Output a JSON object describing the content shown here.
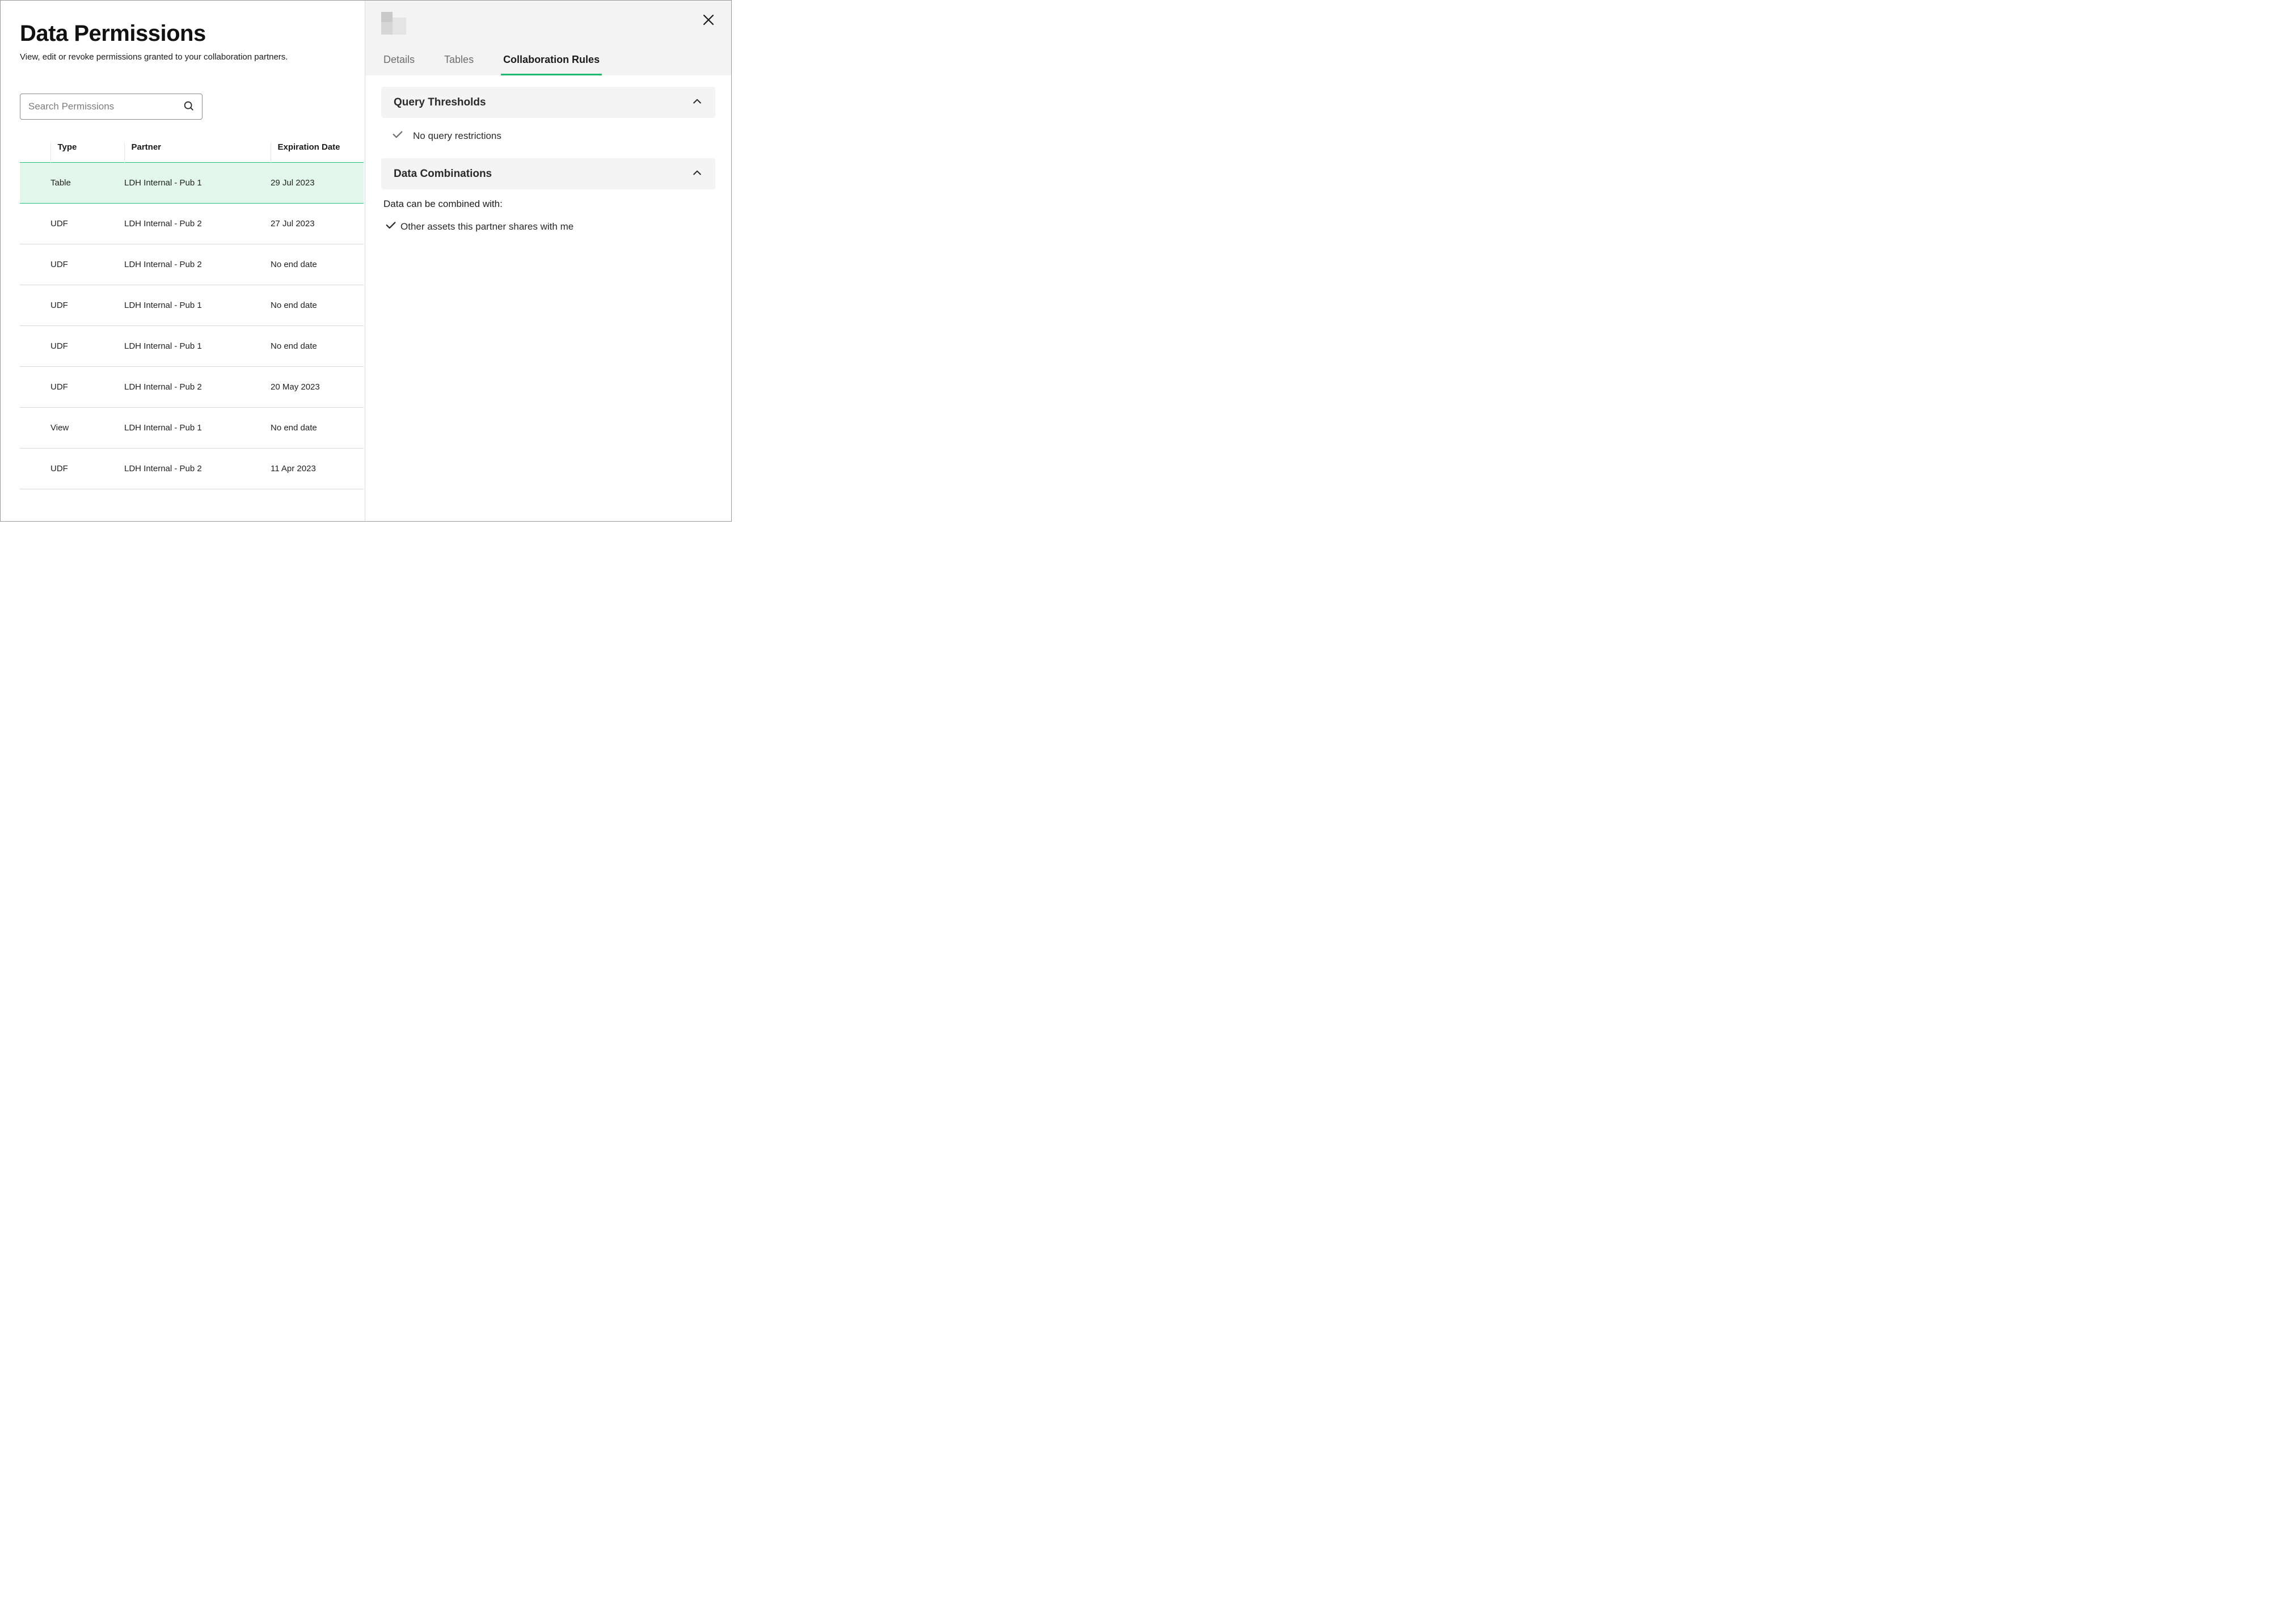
{
  "page": {
    "title": "Data Permissions",
    "subtitle": "View, edit or revoke permissions granted to your collaboration partners."
  },
  "search": {
    "placeholder": "Search Permissions"
  },
  "table": {
    "columns": {
      "type": "Type",
      "partner": "Partner",
      "expiration": "Expiration Date"
    },
    "rows": [
      {
        "type": "Table",
        "partner": "LDH Internal - Pub 1",
        "expiration": "29 Jul 2023",
        "selected": true
      },
      {
        "type": "UDF",
        "partner": "LDH Internal - Pub 2",
        "expiration": "27 Jul 2023"
      },
      {
        "type": "UDF",
        "partner": "LDH Internal - Pub 2",
        "expiration": "No end date"
      },
      {
        "type": "UDF",
        "partner": "LDH Internal - Pub 1",
        "expiration": "No end date"
      },
      {
        "type": "UDF",
        "partner": "LDH Internal - Pub 1",
        "expiration": "No end date"
      },
      {
        "type": "UDF",
        "partner": "LDH Internal - Pub 2",
        "expiration": "20 May 2023"
      },
      {
        "type": "View",
        "partner": "LDH Internal - Pub 1",
        "expiration": "No end date"
      },
      {
        "type": "UDF",
        "partner": "LDH Internal - Pub 2",
        "expiration": "11 Apr 2023"
      }
    ]
  },
  "panel": {
    "tabs": {
      "details": "Details",
      "tables": "Tables",
      "rules": "Collaboration Rules"
    },
    "active_tab": "rules",
    "sections": {
      "queryThresholds": {
        "title": "Query Thresholds",
        "status": "No query restrictions"
      },
      "dataCombinations": {
        "title": "Data Combinations",
        "intro": "Data can be combined with:",
        "item": "Other assets this partner shares with me"
      }
    }
  }
}
